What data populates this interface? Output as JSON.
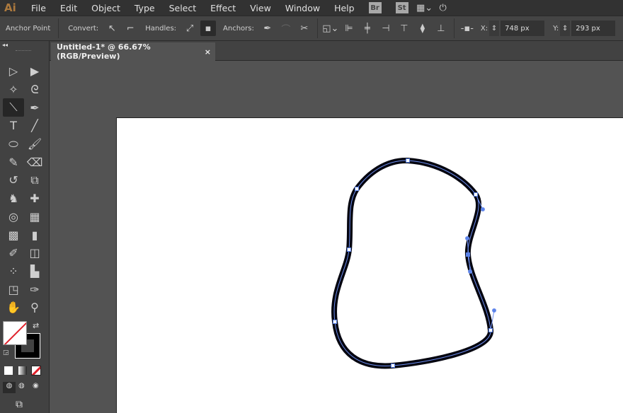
{
  "app": {
    "logo": "Ai",
    "menus": [
      "File",
      "Edit",
      "Object",
      "Type",
      "Select",
      "Effect",
      "View",
      "Window",
      "Help"
    ],
    "bridge": "Br",
    "stock": "St"
  },
  "control": {
    "tool_label": "Anchor Point",
    "convert_label": "Convert:",
    "handles_label": "Handles:",
    "anchors_label": "Anchors:",
    "x_label": "X:",
    "x_value": "748 px",
    "y_label": "Y:",
    "y_value": "293 px"
  },
  "tab": {
    "title": "Untitled-1* @ 66.67% (RGB/Preview)",
    "close": "×"
  },
  "tools": [
    {
      "name": "selection-tool",
      "glyph": "▷"
    },
    {
      "name": "direct-selection-tool",
      "glyph": "▶"
    },
    {
      "name": "magic-wand-tool",
      "glyph": "✧"
    },
    {
      "name": "lasso-tool",
      "glyph": "ᘓ"
    },
    {
      "name": "anchor-point-tool",
      "glyph": "⟍",
      "active": true
    },
    {
      "name": "pen-tool",
      "glyph": "✒"
    },
    {
      "name": "type-tool",
      "glyph": "T"
    },
    {
      "name": "line-tool",
      "glyph": "╱"
    },
    {
      "name": "ellipse-tool",
      "glyph": "⬭"
    },
    {
      "name": "paintbrush-tool",
      "glyph": "🖌"
    },
    {
      "name": "blob-brush-tool",
      "glyph": "✎"
    },
    {
      "name": "eraser-tool",
      "glyph": "⌫"
    },
    {
      "name": "rotate-tool",
      "glyph": "↺"
    },
    {
      "name": "scale-tool",
      "glyph": "⧉"
    },
    {
      "name": "puppet-warp-tool",
      "glyph": "♞"
    },
    {
      "name": "pin-tool",
      "glyph": "✚"
    },
    {
      "name": "shape-builder-tool",
      "glyph": "◎"
    },
    {
      "name": "perspective-grid-tool",
      "glyph": "▦"
    },
    {
      "name": "mesh-tool",
      "glyph": "▩"
    },
    {
      "name": "gradient-tool",
      "glyph": "▮"
    },
    {
      "name": "eyedropper-tool",
      "glyph": "✐"
    },
    {
      "name": "blend-tool",
      "glyph": "◫"
    },
    {
      "name": "symbol-sprayer-tool",
      "glyph": "⁘"
    },
    {
      "name": "column-graph-tool",
      "glyph": "▙"
    },
    {
      "name": "artboard-tool",
      "glyph": "◳"
    },
    {
      "name": "slice-tool",
      "glyph": "✑"
    },
    {
      "name": "hand-tool",
      "glyph": "✋"
    },
    {
      "name": "zoom-tool",
      "glyph": "⚲"
    }
  ],
  "colors": {
    "fill": "none",
    "stroke": "#000000",
    "path_highlight": "#4f7fe8",
    "canvas": "#535353"
  }
}
